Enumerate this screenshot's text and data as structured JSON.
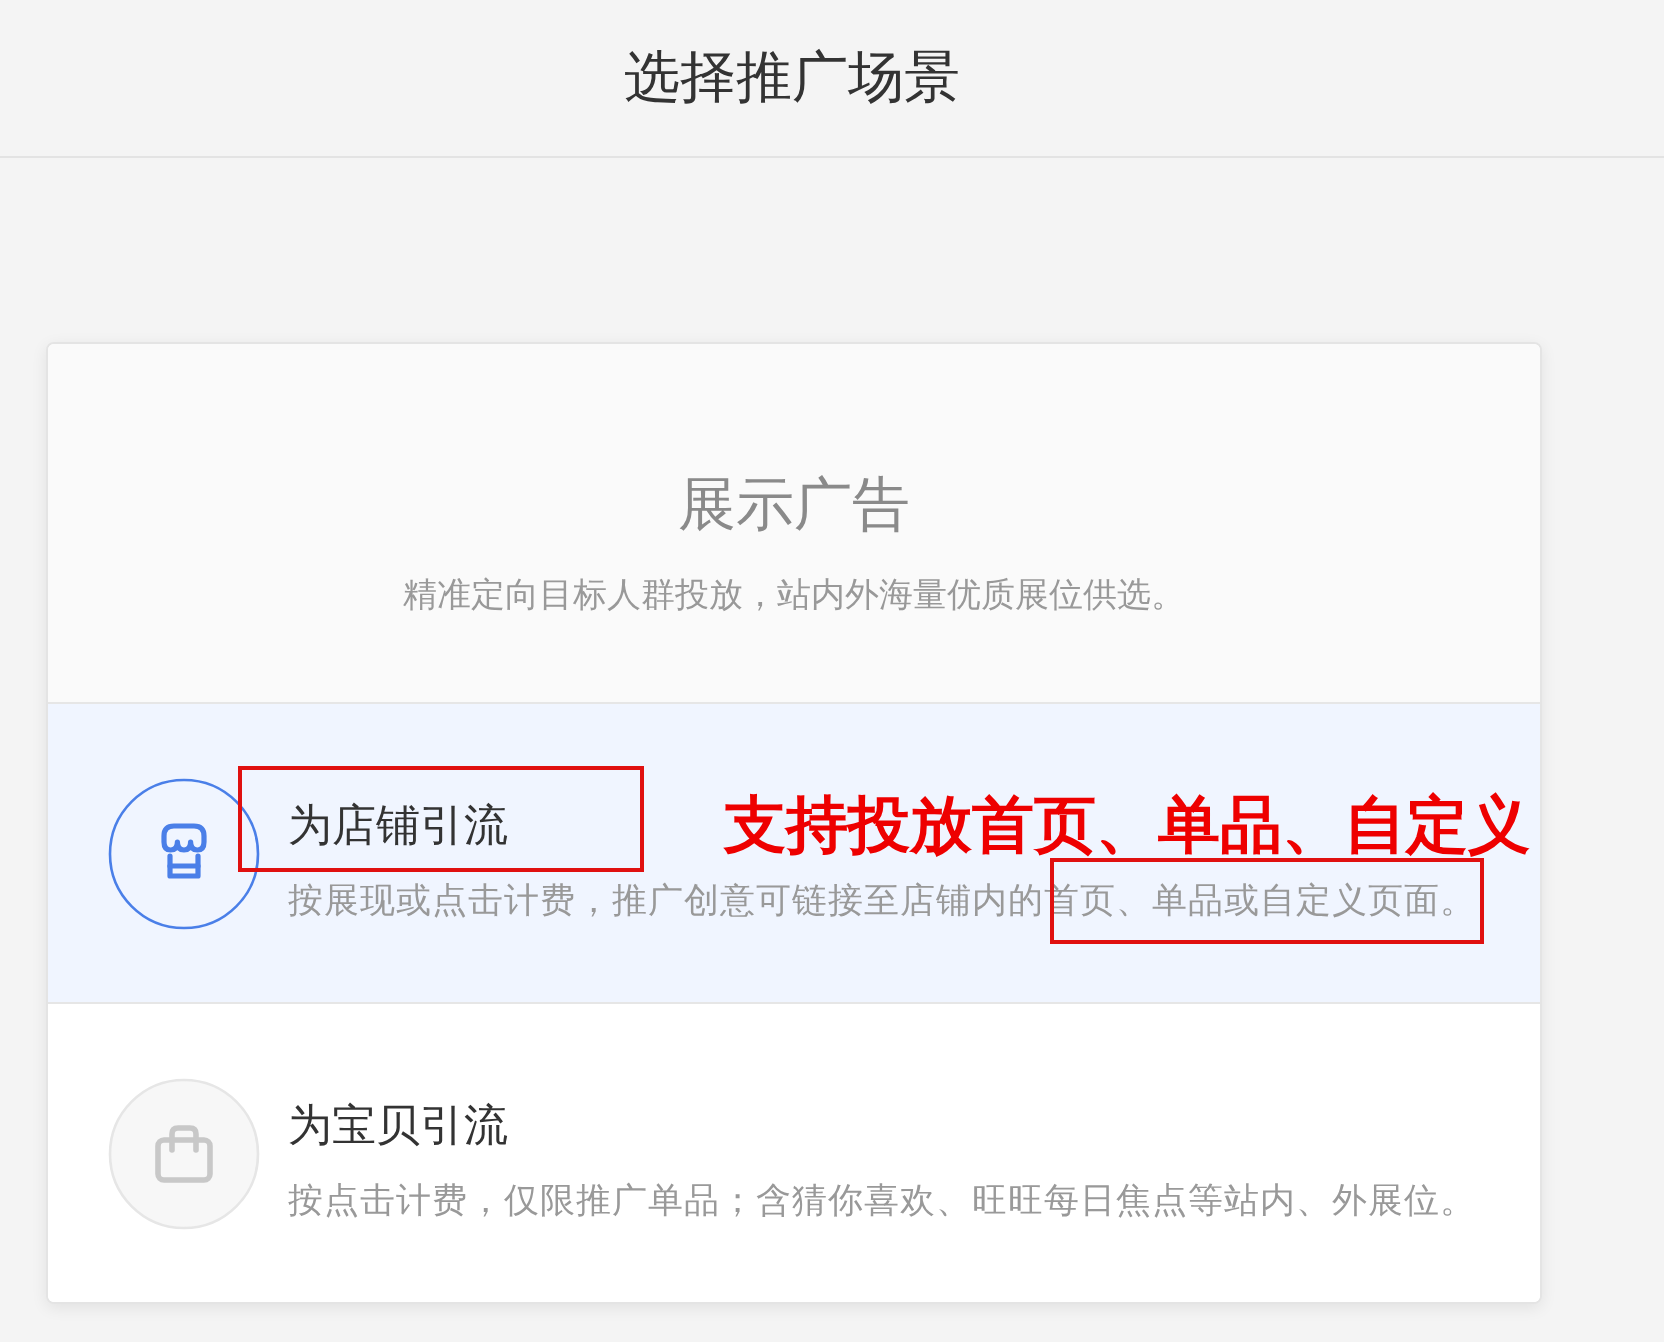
{
  "header": {
    "title": "选择推广场景"
  },
  "card": {
    "heading": "展示广告",
    "subtitle": "精准定向目标人群投放，站内外海量优质展位供选。",
    "scenes": [
      {
        "kind": "shop",
        "title": "为店铺引流",
        "description": "按展现或点击计费，推广创意可链接至店铺内的首页、单品或自定义页面。",
        "selected": true,
        "annotation": {
          "text": "支持投放首页、单品、自定义"
        }
      },
      {
        "kind": "product",
        "title": "为宝贝引流",
        "description": "按点击计费，仅限推广单品；含猜你喜欢、旺旺每日焦点等站内、外展位。",
        "selected": false
      }
    ]
  }
}
